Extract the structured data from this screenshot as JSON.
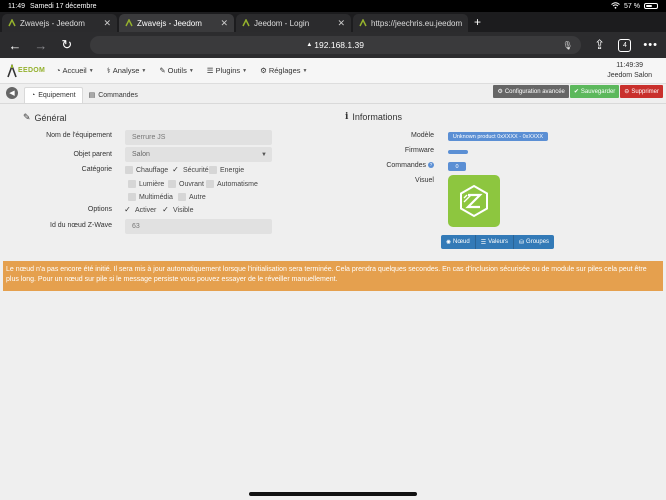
{
  "status_bar": {
    "time": "11:49",
    "date": "Samedi 17 décembre",
    "battery": "57 %",
    "battery_level": 0.57
  },
  "browser": {
    "tabs": [
      {
        "label": "Zwavejs - Jeedom",
        "active": false
      },
      {
        "label": "Zwavejs - Jeedom",
        "active": true
      },
      {
        "label": "Jeedom - Login",
        "active": false
      },
      {
        "label": "https://jeechris.eu.jeedom",
        "active": false
      }
    ],
    "new_tab": "+",
    "url": "192.168.1.39",
    "tab_count": "4"
  },
  "app": {
    "logo": "EEDOM",
    "menu": [
      "Accueil",
      "Analyse",
      "Outils",
      "Plugins",
      "Réglages"
    ],
    "clock_time": "11:49:39",
    "clock_location": "Jeedom Salon"
  },
  "subtabs": {
    "equipement": "Equipement",
    "commandes": "Commandes"
  },
  "actions": {
    "config": "Configuration avancée",
    "save": "Sauvegarder",
    "delete": "Supprimer"
  },
  "general": {
    "title": "Général",
    "name_label": "Nom de l'équipement",
    "name_value": "Serrure JS",
    "parent_label": "Objet parent",
    "parent_value": "Salon",
    "category_label": "Catégorie",
    "categories": [
      {
        "label": "Chauffage",
        "checked": false
      },
      {
        "label": "Sécurité",
        "checked": true
      },
      {
        "label": "Energie",
        "checked": false
      },
      {
        "label": "Lumière",
        "checked": false
      },
      {
        "label": "Ouvrant",
        "checked": false
      },
      {
        "label": "Automatisme",
        "checked": false
      },
      {
        "label": "Multimédia",
        "checked": false
      },
      {
        "label": "Autre",
        "checked": false
      }
    ],
    "options_label": "Options",
    "options": [
      {
        "label": "Activer",
        "checked": true
      },
      {
        "label": "Visible",
        "checked": true
      }
    ],
    "node_id_label": "Id du nœud Z-Wave",
    "node_id_value": "63"
  },
  "informations": {
    "title": "Informations",
    "model_label": "Modèle",
    "model_value": "Unknown product 0xXXXX - 0xXXXX",
    "firmware_label": "Firmware",
    "commands_label": "Commandes",
    "commands_value": "0",
    "visuel_label": "Visuel",
    "buttons": [
      "Nœud",
      "Valeurs",
      "Groupes"
    ]
  },
  "alert": "Le nœud n'a pas encore été initié. Il sera mis à jour automatiquement lorsque l'initialisation sera terminée. Cela prendra quelques secondes. En cas d'inclusion sécurisée ou de module sur piles cela peut être plus long. Pour un nœud sur pile si le message persiste vous pouvez essayer de le réveiller manuellement.",
  "colors": {
    "accent": "#8dc63f",
    "alert": "#e5a04e",
    "badge": "#5b8fd4",
    "save": "#5cb85c",
    "delete": "#c9302c"
  }
}
